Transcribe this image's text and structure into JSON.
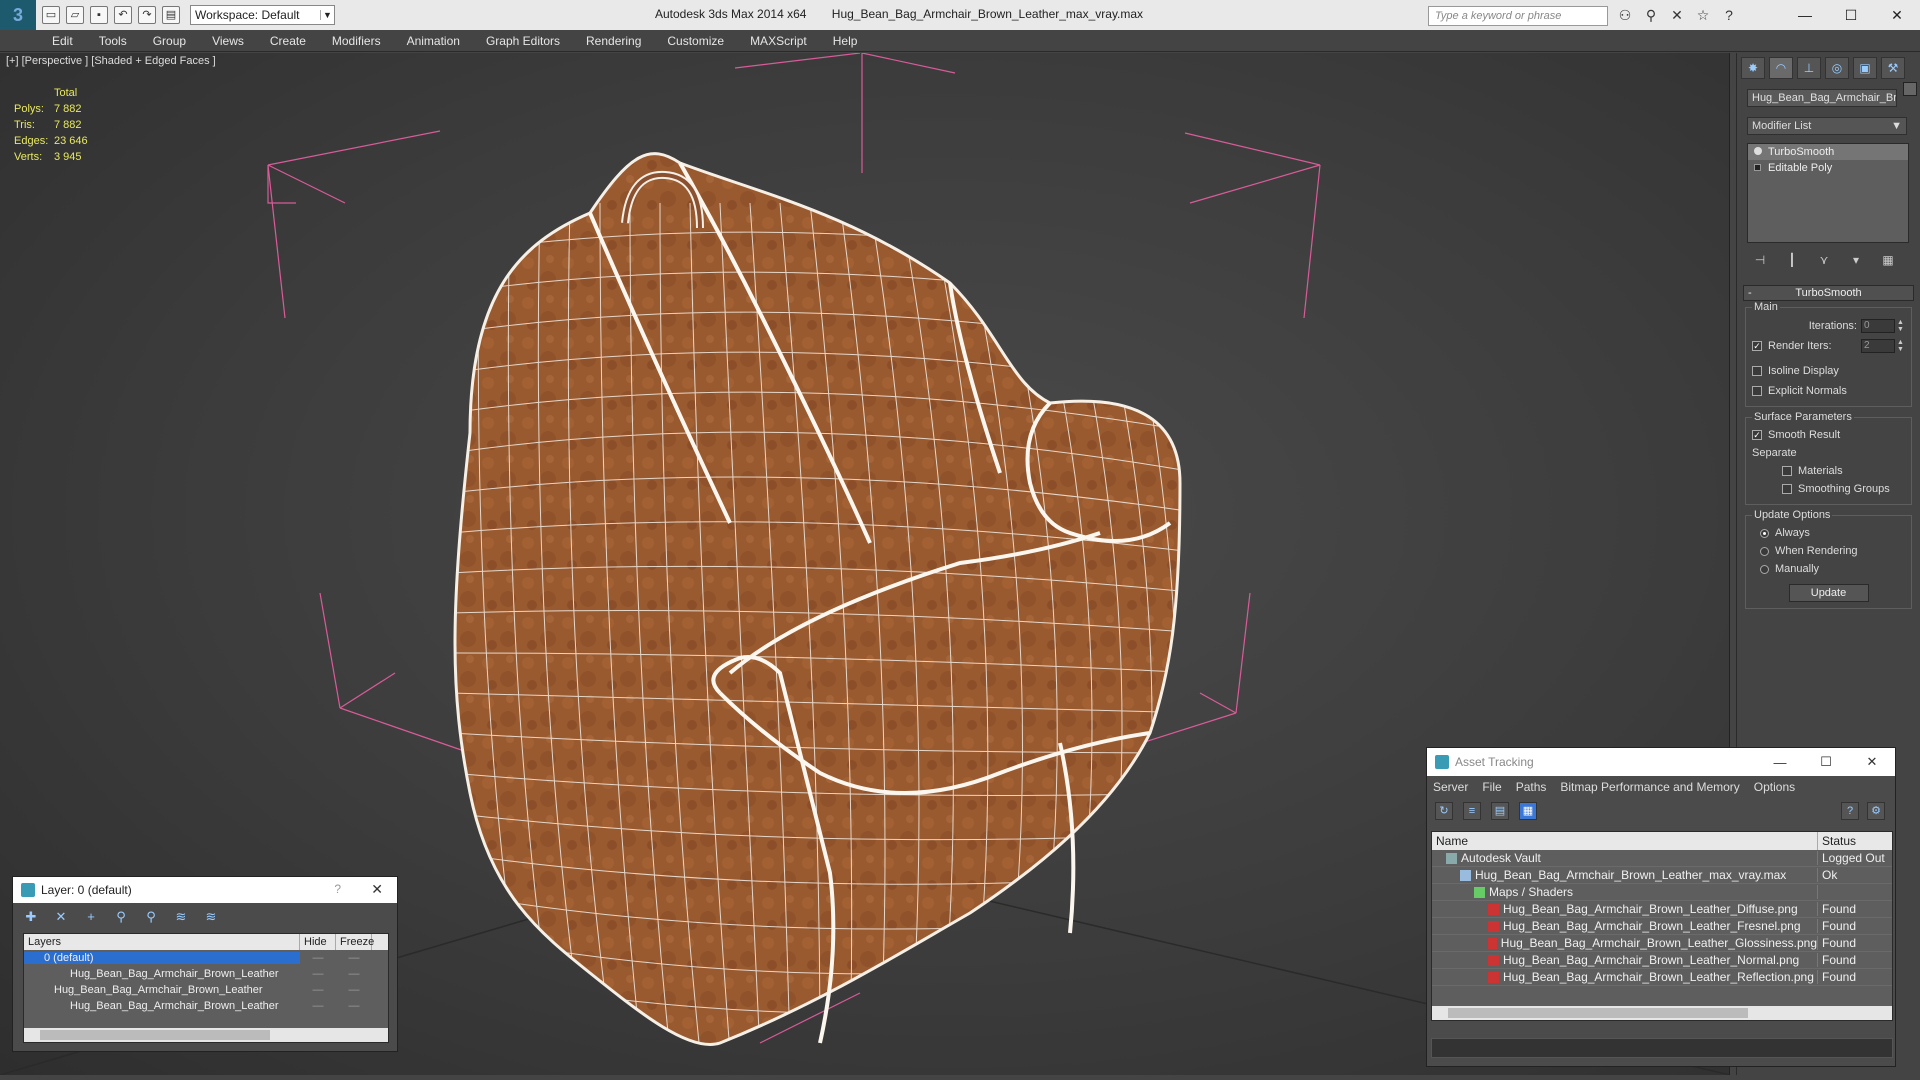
{
  "titlebar": {
    "app": "Autodesk 3ds Max  2014 x64",
    "file": "Hug_Bean_Bag_Armchair_Brown_Leather_max_vray.max",
    "workspace": "Workspace: Default",
    "search_placeholder": "Type a keyword or phrase"
  },
  "menu": [
    "Edit",
    "Tools",
    "Group",
    "Views",
    "Create",
    "Modifiers",
    "Animation",
    "Graph Editors",
    "Rendering",
    "Customize",
    "MAXScript",
    "Help"
  ],
  "viewport": {
    "label": "[+] [Perspective ] [Shaded + Edged Faces ]",
    "stats": {
      "header": "Total",
      "rows": [
        {
          "k": "Polys:",
          "v": "7 882"
        },
        {
          "k": "Tris:",
          "v": "7 882"
        },
        {
          "k": "Edges:",
          "v": "23 646"
        },
        {
          "k": "Verts:",
          "v": "3 945"
        }
      ]
    }
  },
  "command_panel": {
    "object_name": "Hug_Bean_Bag_Armchair_Bro",
    "modifier_list": "Modifier List",
    "stack": [
      "TurboSmooth",
      "Editable Poly"
    ],
    "rollout": "TurboSmooth",
    "main_group": "Main",
    "iterations_label": "Iterations:",
    "iterations_value": "0",
    "render_iters_label": "Render Iters:",
    "render_iters_value": "2",
    "isoline": "Isoline Display",
    "explicit_normals": "Explicit Normals",
    "surface_group": "Surface Parameters",
    "smooth_result": "Smooth Result",
    "separate": "Separate",
    "materials": "Materials",
    "smoothing_groups": "Smoothing Groups",
    "update_group": "Update Options",
    "always": "Always",
    "when_rendering": "When Rendering",
    "manually": "Manually",
    "update_btn": "Update"
  },
  "layer_dialog": {
    "title": "Layer: 0 (default)",
    "help": "?",
    "col_layers": "Layers",
    "col_hide": "Hide",
    "col_freeze": "Freeze",
    "rows": [
      {
        "name": "0 (default)",
        "indent": 0,
        "sel": true
      },
      {
        "name": "Hug_Bean_Bag_Armchair_Brown_Leather",
        "indent": 2,
        "sel": false
      },
      {
        "name": "Hug_Bean_Bag_Armchair_Brown_Leather",
        "indent": 0,
        "sel": false
      },
      {
        "name": "Hug_Bean_Bag_Armchair_Brown_Leather",
        "indent": 2,
        "sel": false
      }
    ]
  },
  "asset_tracking": {
    "title": "Asset Tracking",
    "menu": [
      "Server",
      "File",
      "Paths",
      "Bitmap Performance and Memory",
      "Options"
    ],
    "col_name": "Name",
    "col_status": "Status",
    "rows": [
      {
        "name": "Autodesk Vault",
        "status": "Logged Out",
        "indent": 1,
        "icon": "vault"
      },
      {
        "name": "Hug_Bean_Bag_Armchair_Brown_Leather_max_vray.max",
        "status": "Ok",
        "indent": 2,
        "icon": "max"
      },
      {
        "name": "Maps / Shaders",
        "status": "",
        "indent": 3,
        "icon": "maps"
      },
      {
        "name": "Hug_Bean_Bag_Armchair_Brown_Leather_Diffuse.png",
        "status": "Found",
        "indent": 4,
        "icon": "png"
      },
      {
        "name": "Hug_Bean_Bag_Armchair_Brown_Leather_Fresnel.png",
        "status": "Found",
        "indent": 4,
        "icon": "png"
      },
      {
        "name": "Hug_Bean_Bag_Armchair_Brown_Leather_Glossiness.png",
        "status": "Found",
        "indent": 4,
        "icon": "png"
      },
      {
        "name": "Hug_Bean_Bag_Armchair_Brown_Leather_Normal.png",
        "status": "Found",
        "indent": 4,
        "icon": "png"
      },
      {
        "name": "Hug_Bean_Bag_Armchair_Brown_Leather_Reflection.png",
        "status": "Found",
        "indent": 4,
        "icon": "png"
      }
    ]
  },
  "colors": {
    "leather": "#9a5a30",
    "wire": "#f2f2f2",
    "bbox": "#e060a0",
    "selection": "#2a6ecf"
  }
}
